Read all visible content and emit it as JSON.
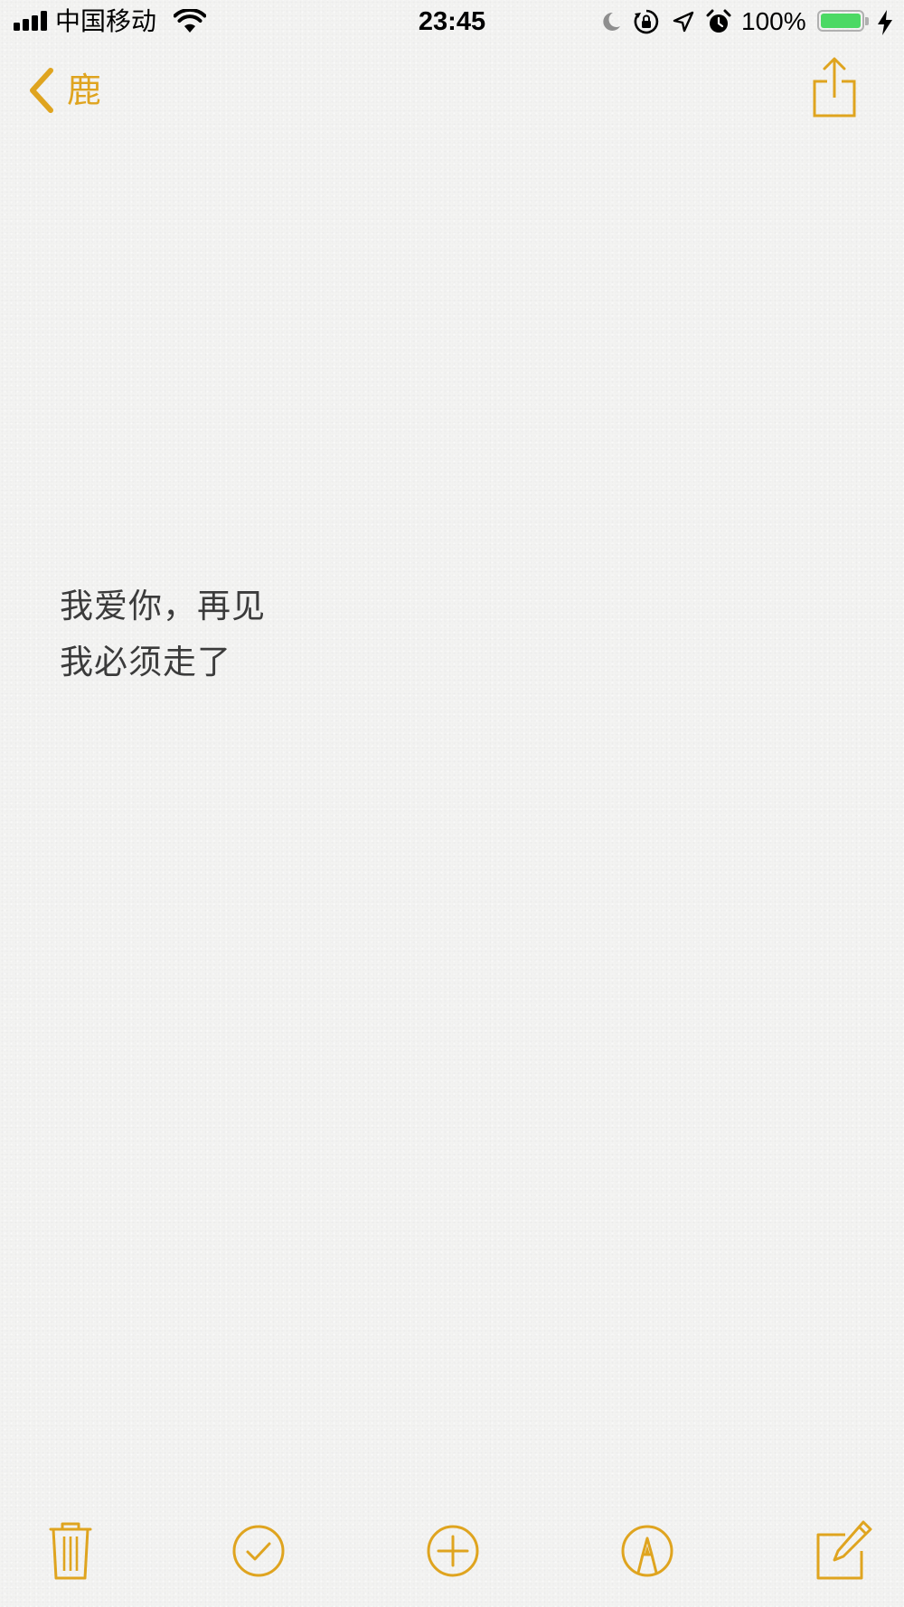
{
  "status_bar": {
    "carrier": "中国移动",
    "time": "23:45",
    "battery_percent": "100%",
    "battery_level": 1.0,
    "battery_color": "#4cd964",
    "icons": [
      "signal-icon",
      "wifi-icon",
      "moon-icon",
      "orientation-lock-icon",
      "location-icon",
      "alarm-icon",
      "battery-icon",
      "charging-icon"
    ]
  },
  "nav": {
    "back_label": "鹿",
    "back_icon": "chevron-left-icon",
    "share_icon": "share-icon"
  },
  "note": {
    "lines": [
      "我爱你，再见",
      "我必须走了"
    ]
  },
  "toolbar": {
    "icons": [
      "trash-icon",
      "checklist-icon",
      "add-icon",
      "markup-icon",
      "compose-icon"
    ]
  },
  "colors": {
    "accent": "#dfa41f",
    "text": "#3b3b3b",
    "background": "#f3f3f2"
  }
}
